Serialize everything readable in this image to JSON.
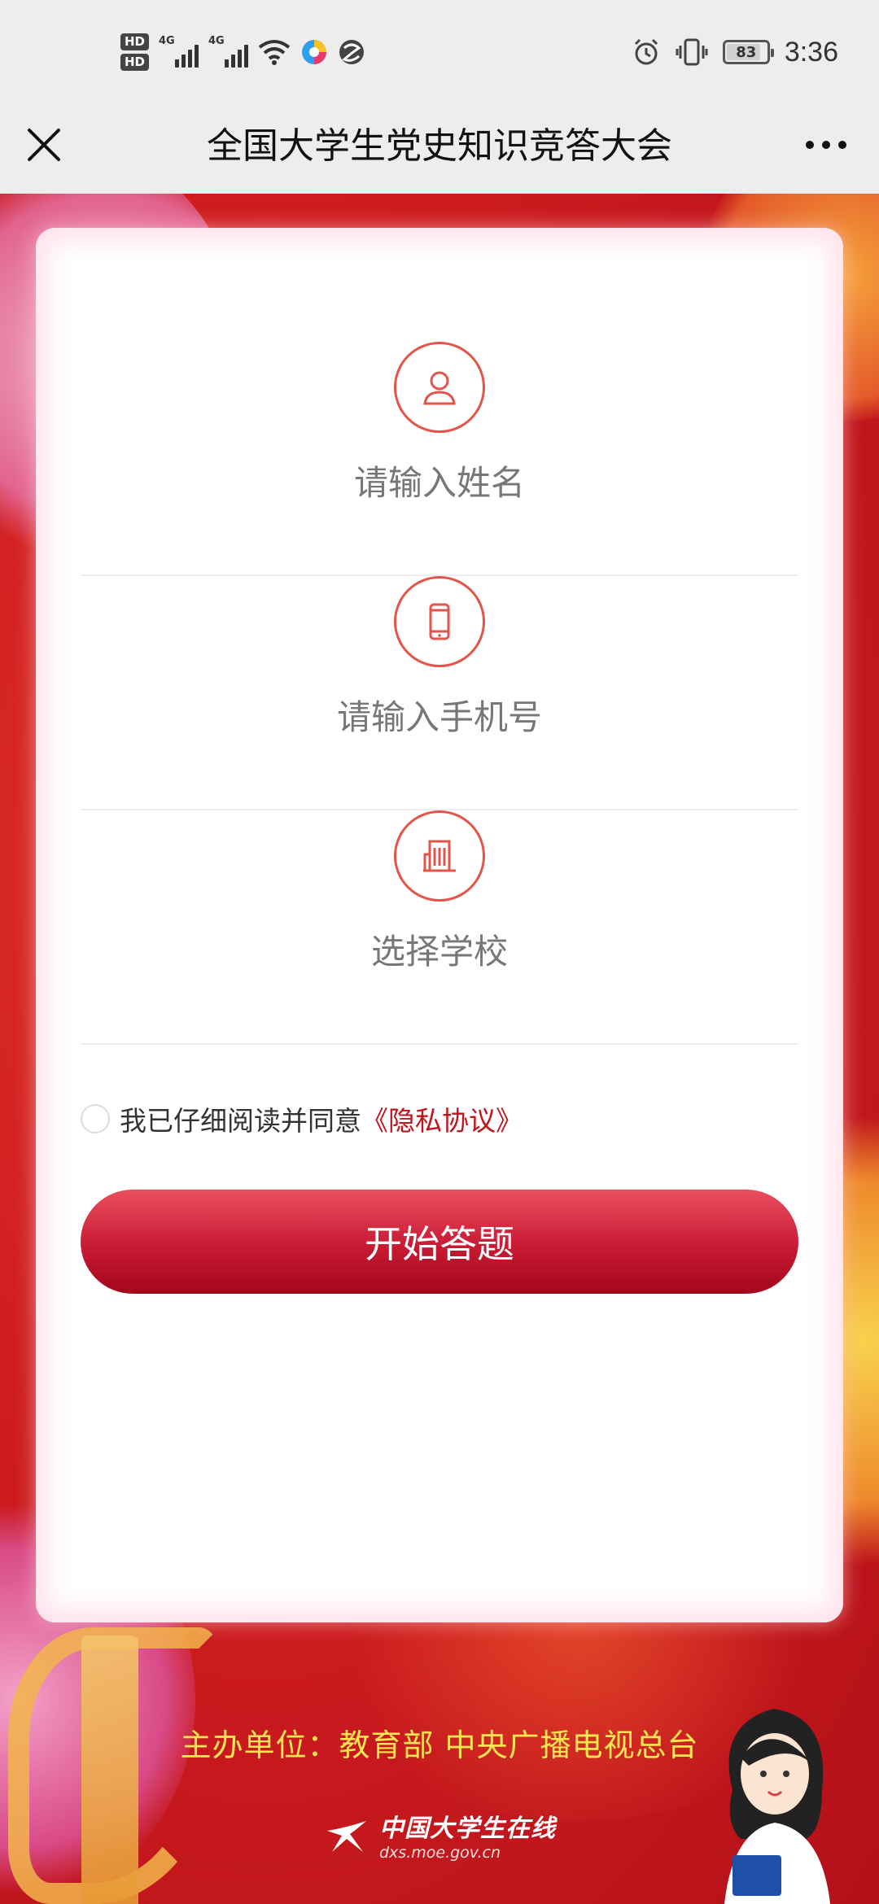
{
  "status_bar": {
    "hd1": "HD",
    "hd2": "HD",
    "net1": "4G",
    "net2": "4G",
    "battery": "83",
    "time": "3:36"
  },
  "title_bar": {
    "title": "全国大学生党史知识竞答大会"
  },
  "form": {
    "name_label": "请输入姓名",
    "phone_label": "请输入手机号",
    "school_label": "选择学校",
    "agree_text": "我已仔细阅读并同意",
    "agree_link": "《隐私协议》",
    "submit_label": "开始答题"
  },
  "footer": {
    "sponsor": "主办单位：教育部   中央广播电视总台",
    "logo_name": "中国大学生在线",
    "logo_url": "dxs.moe.gov.cn"
  },
  "colors": {
    "accent": "#c81a33",
    "link": "#c2141c",
    "sponsor_text": "#fbe552"
  }
}
